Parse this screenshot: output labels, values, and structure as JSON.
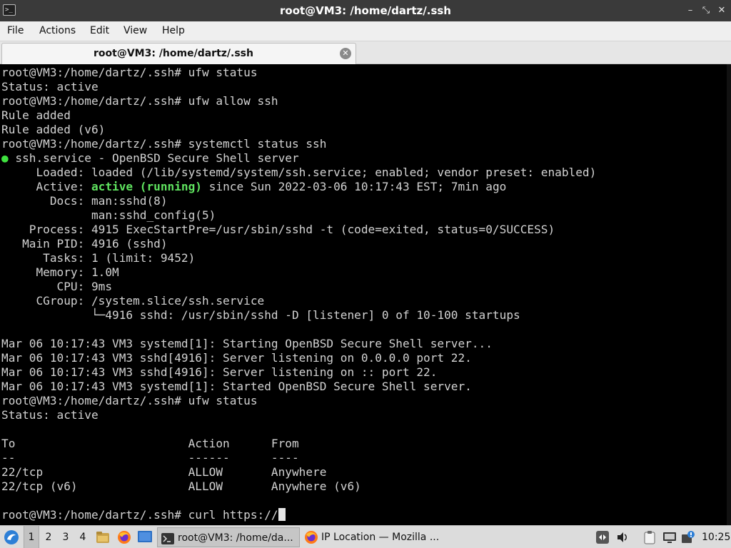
{
  "window": {
    "title": "root@VM3: /home/dartz/.ssh",
    "app_icon_text": ">_",
    "controls": {
      "minimize": "–",
      "maximize": "⤡",
      "close": "✕"
    }
  },
  "menubar": {
    "items": [
      "File",
      "Actions",
      "Edit",
      "View",
      "Help"
    ]
  },
  "tab": {
    "label": "root@VM3: /home/dartz/.ssh",
    "close_glyph": "✕"
  },
  "terminal": {
    "lines": [
      "root@VM3:/home/dartz/.ssh# ufw status",
      "Status: active",
      "root@VM3:/home/dartz/.ssh# ufw allow ssh",
      "Rule added",
      "Rule added (v6)",
      "root@VM3:/home/dartz/.ssh# systemctl status ssh",
      " ssh.service - OpenBSD Secure Shell server",
      "     Loaded: loaded (/lib/systemd/system/ssh.service; enabled; vendor preset: enabled)",
      "     Active: active (running) since Sun 2022-03-06 10:17:43 EST; 7min ago",
      "       Docs: man:sshd(8)",
      "             man:sshd_config(5)",
      "    Process: 4915 ExecStartPre=/usr/sbin/sshd -t (code=exited, status=0/SUCCESS)",
      "   Main PID: 4916 (sshd)",
      "      Tasks: 1 (limit: 9452)",
      "     Memory: 1.0M",
      "        CPU: 9ms",
      "     CGroup: /system.slice/ssh.service",
      "             └─4916 sshd: /usr/sbin/sshd -D [listener] 0 of 10-100 startups",
      "",
      "Mar 06 10:17:43 VM3 systemd[1]: Starting OpenBSD Secure Shell server...",
      "Mar 06 10:17:43 VM3 sshd[4916]: Server listening on 0.0.0.0 port 22.",
      "Mar 06 10:17:43 VM3 sshd[4916]: Server listening on :: port 22.",
      "Mar 06 10:17:43 VM3 systemd[1]: Started OpenBSD Secure Shell server.",
      "root@VM3:/home/dartz/.ssh# ufw status",
      "Status: active",
      "",
      "To                         Action      From",
      "--                         ------      ----",
      "22/tcp                     ALLOW       Anywhere",
      "22/tcp (v6)                ALLOW       Anywhere (v6)",
      "",
      "root@VM3:/home/dartz/.ssh# curl https://"
    ],
    "status_dot": "●",
    "active_state_text": "active (running)",
    "colors": {
      "background": "#000000",
      "foreground": "#d2d2d2",
      "highlight_green": "#5fe35f"
    }
  },
  "taskbar": {
    "start_icon": "lxqt-menu-icon",
    "desktops": [
      "1",
      "2",
      "3",
      "4"
    ],
    "active_desktop": "1",
    "quicklaunch": [
      "file-manager-icon",
      "firefox-icon",
      "desktop-icon"
    ],
    "tasks": [
      {
        "label": "root@VM3: /home/da...",
        "icon": "terminal-icon",
        "active": true
      },
      {
        "label": "IP Location — Mozilla ...",
        "icon": "firefox-icon",
        "active": false
      }
    ],
    "tray_icons": [
      "nav-arrows-icon",
      "volume-icon",
      "clipboard-icon",
      "network-icon",
      "update-notifier-icon"
    ],
    "clock": "10:25"
  }
}
